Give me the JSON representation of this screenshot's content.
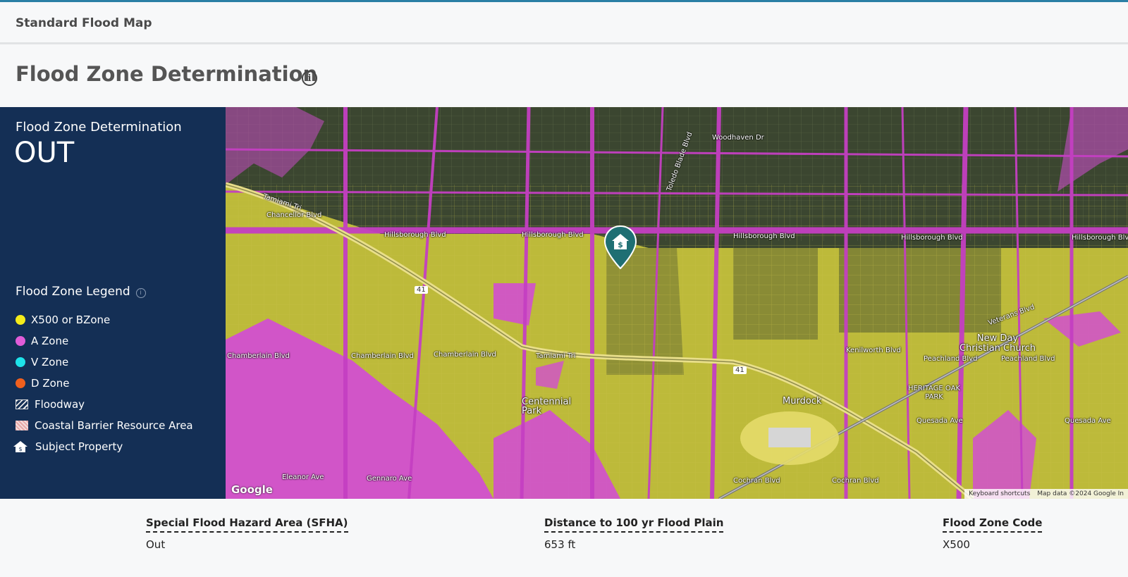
{
  "tab": {
    "title": "Standard Flood Map"
  },
  "header": {
    "title": "Flood Zone Determination",
    "info_icon": "info-circle-icon"
  },
  "determination": {
    "label": "Flood Zone Determination",
    "value": "OUT"
  },
  "legend": {
    "title": "Flood Zone Legend",
    "items": [
      {
        "label": "X500 or BZone",
        "color": "#f5ec1a"
      },
      {
        "label": "A Zone",
        "color": "#e15cd8"
      },
      {
        "label": "V Zone",
        "color": "#1ee3ea"
      },
      {
        "label": "D Zone",
        "color": "#f0601e"
      },
      {
        "label": "Floodway",
        "icon": "hatch-pattern"
      },
      {
        "label": "Coastal Barrier Resource Area",
        "icon": "cbra-pattern"
      },
      {
        "label": "Subject Property",
        "icon": "house-icon"
      }
    ]
  },
  "map": {
    "labels": {
      "tamiami_tri_1": "Tamiami Tri",
      "tamiami_tri_2": "Tamiami Tri",
      "chancellor": "Chancellor Blvd",
      "hillsborough_1": "Hillsborough Blvd",
      "hillsborough_2": "Hillsborough Blvd",
      "hillsborough_3": "Hillsborough Blvd",
      "hillsborough_4": "Hillsborough Blvd",
      "hillsborough_5": "Hillsborough Blvd",
      "chamberlain_1": "Chamberlain Blvd",
      "chamberlain_2": "Chamberlain Blvd",
      "chamberlain_3": "Chamberlain Blvd",
      "woodhaven": "Woodhaven Dr",
      "toledo": "Toledo Blade Blvd",
      "centennial": "Centennial Park",
      "murdock": "Murdock",
      "heritage": "HERITAGE OAK PARK",
      "new_day": "New Day Christian Church",
      "peachland_1": "Peachland Blvd",
      "peachland_2": "Peachland Blvd",
      "kenilworth": "Kenilworth Blvd",
      "veterans": "Veterans Blvd",
      "quesada_1": "Quesada Ave",
      "quesada_2": "Quesada Ave",
      "cochran_1": "Cochran Blvd",
      "cochran_2": "Cochran Blvd",
      "gennaro": "Gennaro Ave",
      "eleanor": "Eleanor Ave",
      "route_41_1": "41",
      "route_41_2": "41"
    },
    "attribution": "Google",
    "footer_shortcuts": "Keyboard shortcuts",
    "footer_data": "Map data ©2024 Google In"
  },
  "stats": [
    {
      "label": "Special Flood Hazard Area (SFHA)",
      "value": "Out"
    },
    {
      "label": "Distance to 100 yr Flood Plain",
      "value": "653 ft"
    },
    {
      "label": "Flood Zone Code",
      "value": "X500"
    }
  ]
}
